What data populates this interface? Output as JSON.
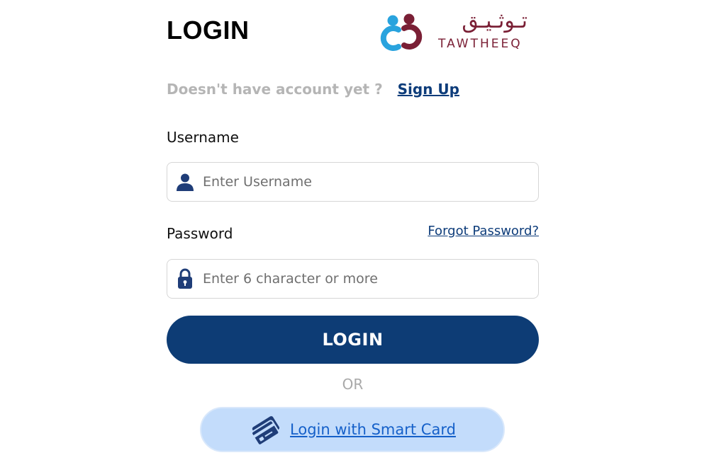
{
  "header": {
    "title": "LOGIN",
    "logo": {
      "arabic_text": "تـوثـيـق",
      "latin_text": "TAWTHEEQ",
      "colors": {
        "blue": "#29a3de",
        "maroon": "#7a1f35"
      }
    }
  },
  "signup": {
    "prompt": "Doesn't have account yet ?",
    "link_label": "Sign Up"
  },
  "username": {
    "label": "Username",
    "placeholder": "Enter Username",
    "value": "",
    "icon": "user-icon"
  },
  "password": {
    "label": "Password",
    "placeholder": "Enter 6 character or more",
    "value": "",
    "icon": "lock-icon",
    "forgot_label": "Forgot Password?"
  },
  "login_button": {
    "label": "LOGIN"
  },
  "divider": {
    "text": "OR"
  },
  "smart_card": {
    "label": "Login with Smart Card",
    "icon": "smart-card-icon"
  },
  "colors": {
    "primary": "#0d3c75",
    "link": "#0d3c7a",
    "muted": "#b5b5b5",
    "smart_card_bg": "#c3dcfb",
    "smart_card_text": "#1560c9"
  }
}
